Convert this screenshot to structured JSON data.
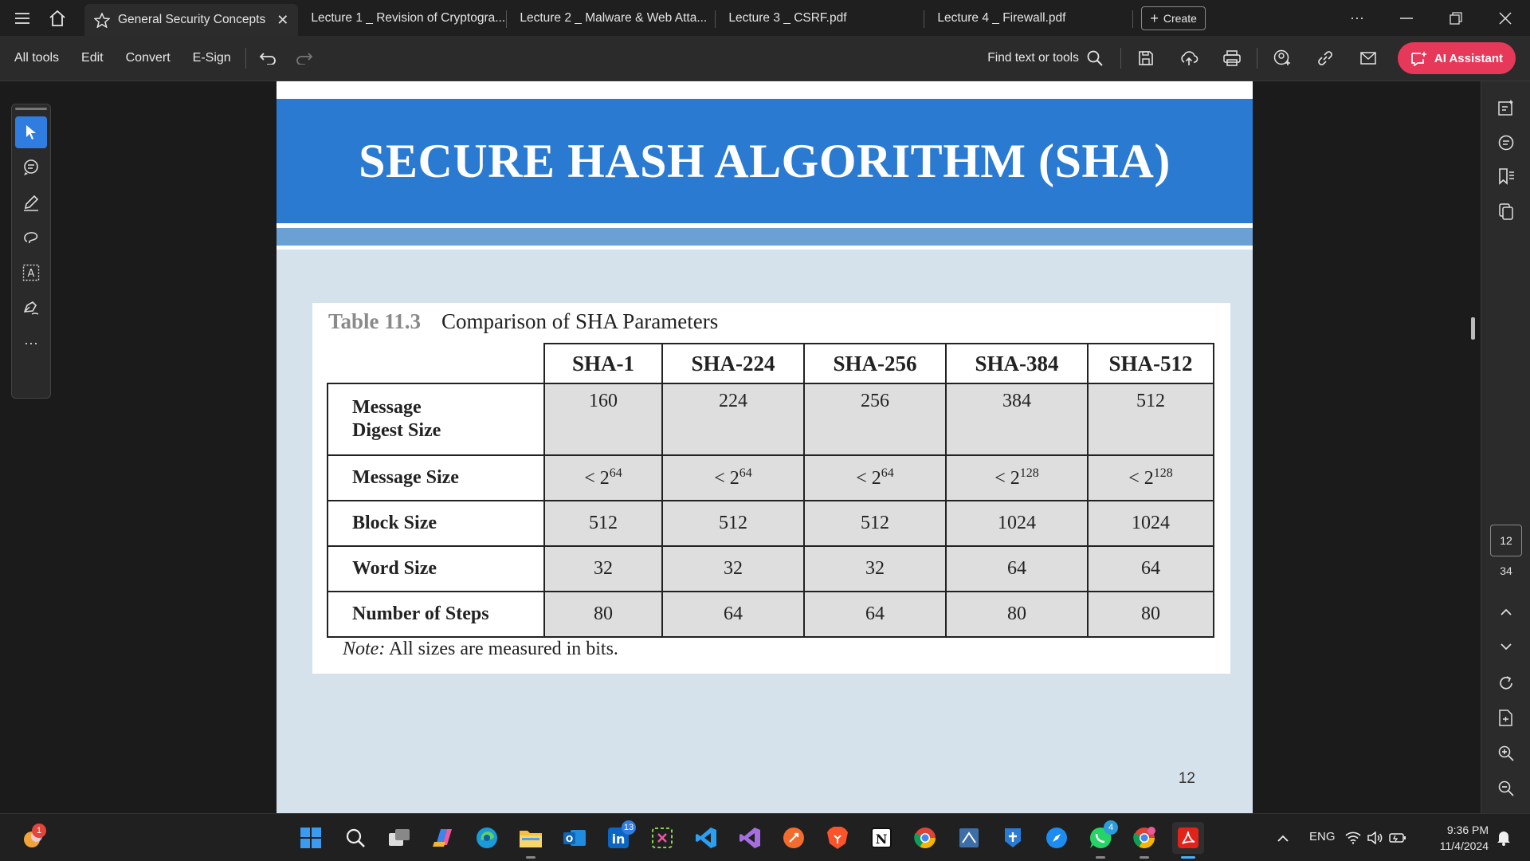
{
  "tabs": [
    {
      "label": "General Security Concepts",
      "active": true
    },
    {
      "label": "Lecture 1 _ Revision of Cryptogra..."
    },
    {
      "label": "Lecture 2 _ Malware & Web Atta..."
    },
    {
      "label": "Lecture 3 _ CSRF.pdf"
    },
    {
      "label": "Lecture 4 _ Firewall.pdf"
    }
  ],
  "create_label": "Create",
  "menu": {
    "all_tools": "All tools",
    "edit": "Edit",
    "convert": "Convert",
    "esign": "E-Sign"
  },
  "find_label": "Find text or tools",
  "ai_label": "AI Assistant",
  "slide": {
    "title": "SECURE HASH ALGORITHM (SHA)",
    "table_number": "Table 11.3",
    "table_title": "Comparison of SHA Parameters",
    "columns": [
      "SHA-1",
      "SHA-224",
      "SHA-256",
      "SHA-384",
      "SHA-512"
    ],
    "rows": [
      {
        "label_line1": "Message",
        "label_line2": "Digest Size",
        "values": [
          "160",
          "224",
          "256",
          "384",
          "512"
        ]
      },
      {
        "label": "Message Size",
        "values": [
          {
            "base": "< 2",
            "exp": "64"
          },
          {
            "base": "< 2",
            "exp": "64"
          },
          {
            "base": "< 2",
            "exp": "64"
          },
          {
            "base": "< 2",
            "exp": "128"
          },
          {
            "base": "< 2",
            "exp": "128"
          }
        ]
      },
      {
        "label": "Block Size",
        "values": [
          "512",
          "512",
          "512",
          "1024",
          "1024"
        ]
      },
      {
        "label": "Word Size",
        "values": [
          "32",
          "32",
          "32",
          "64",
          "64"
        ]
      },
      {
        "label": "Number of Steps",
        "values": [
          "80",
          "64",
          "64",
          "80",
          "80"
        ]
      }
    ],
    "note_label": "Note:",
    "note_text": "All sizes are measured in bits.",
    "page_number": "12"
  },
  "page_nav": {
    "current": "12",
    "total": "34"
  },
  "taskbar": {
    "notif_badge": "1",
    "linkedin_badge": "13",
    "whatsapp_badge": "4"
  },
  "tray": {
    "lang": "ENG",
    "time": "9:36 PM",
    "date": "11/4/2024"
  },
  "colors": {
    "accent": "#2f7de1",
    "banner": "#2b7ad2",
    "ai_button": "#e6395a"
  }
}
